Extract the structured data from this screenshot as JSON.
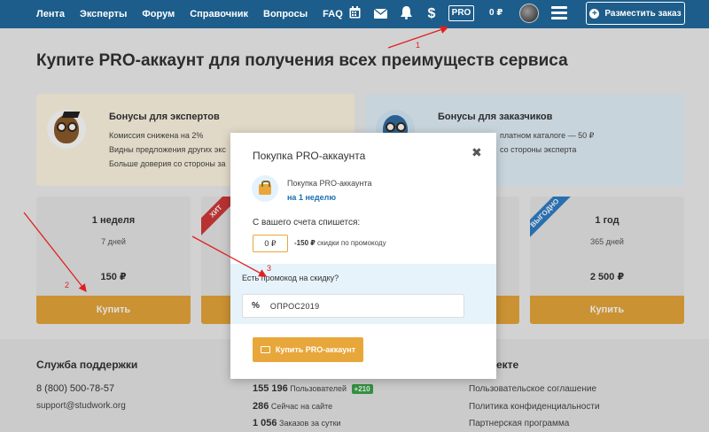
{
  "nav": {
    "links": [
      "Лента",
      "Эксперты",
      "Форум",
      "Справочник",
      "Вопросы",
      "FAQ"
    ],
    "icons": [
      "calendar-icon",
      "mail-icon",
      "bell-icon",
      "dollar-icon"
    ],
    "pro": "PRO",
    "balance": "0 ₽",
    "place_order": "Разместить заказ"
  },
  "page": {
    "title": "Купите PRO-аккаунт для получения всех преимуществ сервиса"
  },
  "bonus_experts": {
    "title": "Бонусы для экспертов",
    "lines": [
      "Комиссия снижена на 2%",
      "Видны предложения других экс",
      "Больше доверия со стороны за"
    ]
  },
  "bonus_customers": {
    "title": "Бонусы для заказчиков",
    "lines": [
      "платном каталоге — 50 ₽",
      "со стороны эксперта"
    ]
  },
  "tariffs": [
    {
      "name": "1 неделя",
      "days": "7 дней",
      "price": "150 ₽",
      "buy": "Купить",
      "ribbon": ""
    },
    {
      "name": "",
      "days": "",
      "price": "",
      "buy": "",
      "ribbon": "ХИТ"
    },
    {
      "name": "1 год",
      "days": "365 дней",
      "price": "2 500 ₽",
      "buy": "Купить",
      "ribbon": "ВЫГОДНО"
    }
  ],
  "footer": {
    "support_title": "Служба поддержки",
    "phone": "8 (800) 500-78-57",
    "email": "support@studwork.org",
    "stats": [
      {
        "num": "155 196",
        "label": "Пользователей",
        "badge": "+210"
      },
      {
        "num": "286",
        "label": "Сейчас на сайте"
      },
      {
        "num": "1 056",
        "label": "Заказов за сутки"
      }
    ],
    "project_title": "екте",
    "links": [
      "Пользовательское соглашение",
      "Политика конфиденциальности",
      "Партнерская программа"
    ]
  },
  "modal": {
    "title": "Покупка PRO-аккаунта",
    "close": "✖",
    "product": "Покупка PRO-аккаунта",
    "period": "на 1 неделю",
    "debit_label": "С вашего счета спишется:",
    "amount": "0 ₽",
    "discount_value": "-150 ₽",
    "discount_label": "скидки по промокоду",
    "promo_question": "Есть промокод на скидку?",
    "promo_prefix": "%",
    "promo_value": "ОПРОС2019",
    "buy": "Купить PRO-аккаунт"
  },
  "annotations": [
    "1",
    "2",
    "3"
  ],
  "colors": {
    "nav": "#1d5d8b",
    "accent": "#e8a73b",
    "link": "#1d6fb0",
    "badge_green": "#3aa549",
    "ribbon_hit": "#d23a3a",
    "ribbon_best": "#2f7fc8",
    "arrow": "#e02020"
  }
}
